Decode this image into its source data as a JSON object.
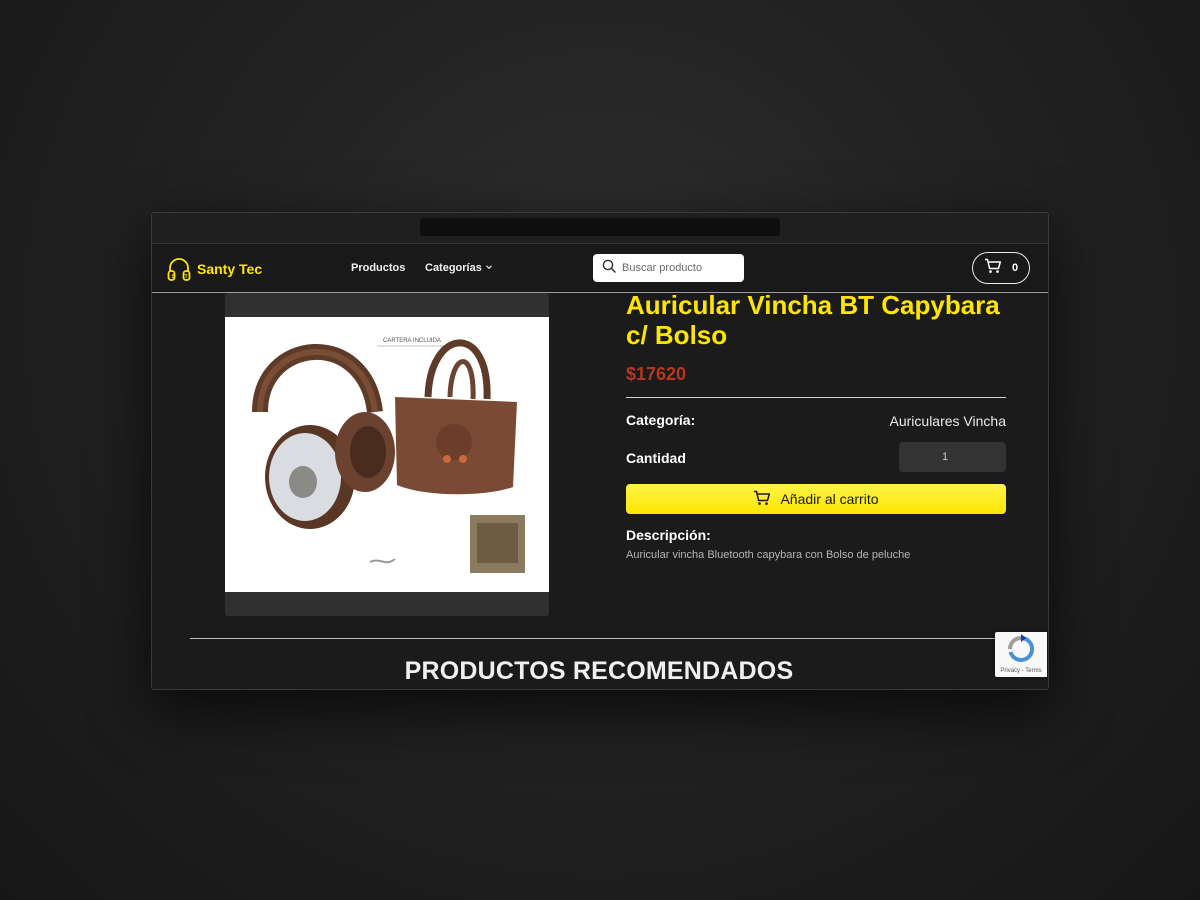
{
  "brand": {
    "name": "Santy Tec",
    "accent": "#ffe600"
  },
  "nav": {
    "products_label": "Productos",
    "categories_label": "Categorías"
  },
  "search": {
    "placeholder": "Buscar producto",
    "value": ""
  },
  "cart": {
    "count": "0"
  },
  "product": {
    "title": "Auricular Vincha BT Capybara c/ Bolso",
    "price": "$17620",
    "price_color": "#b8361d",
    "category_label": "Categoría:",
    "category_value": "Auriculares Vincha",
    "quantity_label": "Cantidad",
    "quantity_value": "1",
    "add_to_cart_label": "Añadir al carrito",
    "description_label": "Descripción:",
    "description_text": "Auricular vincha Bluetooth capybara con Bolso de peluche",
    "image_caption": "CARTERA INCLUIDA"
  },
  "recommended": {
    "title": "PRODUCTOS RECOMENDADOS"
  },
  "recaptcha": {
    "links": "Privacy - Terms"
  }
}
